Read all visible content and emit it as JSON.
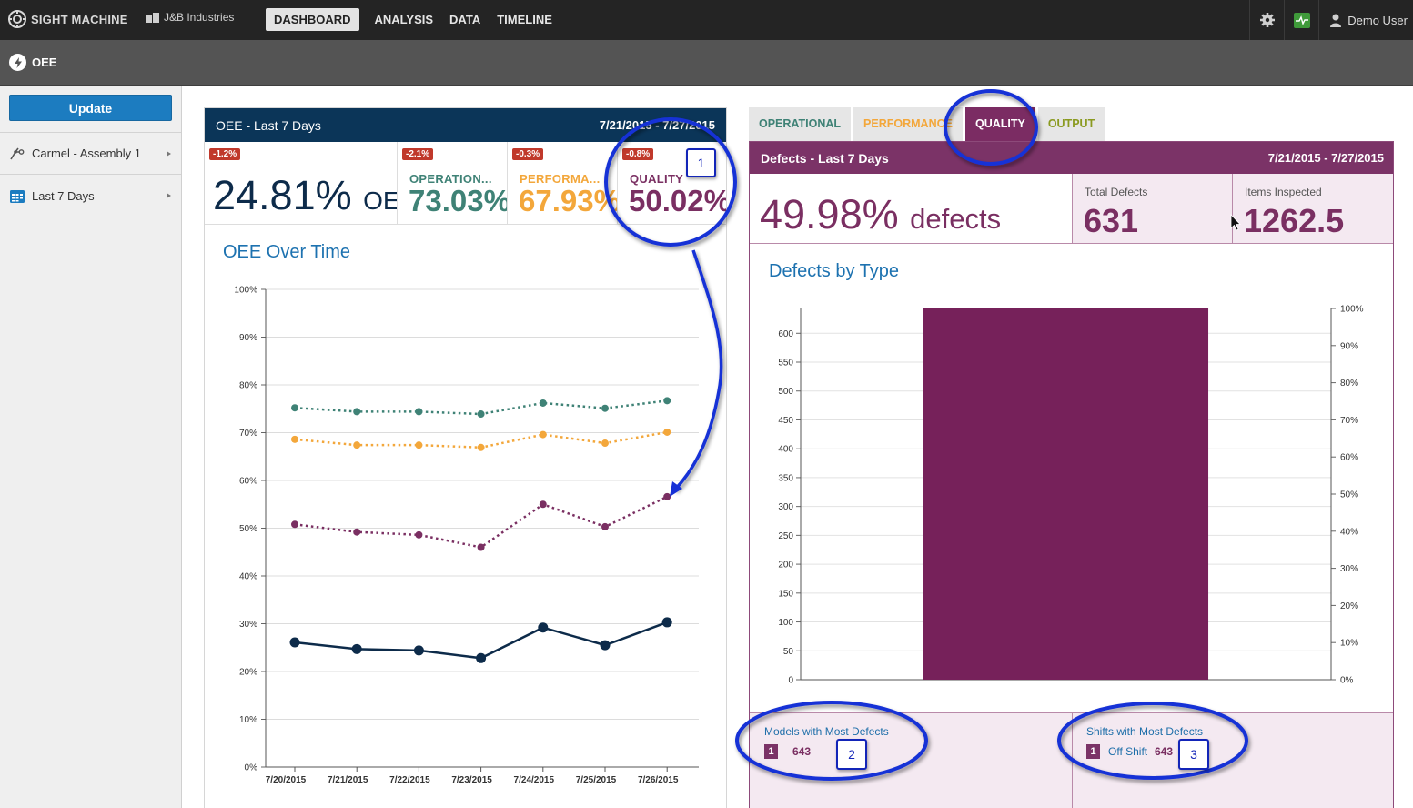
{
  "topbar": {
    "brand": "SIGHT MACHINE",
    "company": "J&B Industries",
    "nav": [
      "DASHBOARD",
      "ANALYSIS",
      "DATA",
      "TIMELINE"
    ],
    "user": "Demo User"
  },
  "subheader": {
    "title": "OEE"
  },
  "sidebar": {
    "update_label": "Update",
    "items": [
      {
        "label": "Carmel - Assembly 1",
        "icon": "machine-icon"
      },
      {
        "label": "Last 7 Days",
        "icon": "calendar-icon"
      }
    ]
  },
  "oee_panel": {
    "title": "OEE - Last 7 Days",
    "date_range": "7/21/2015 - 7/27/2015",
    "kpis": [
      {
        "badge": "-1.2%",
        "label": "",
        "value": "24.81%",
        "unit": "OEE",
        "color": "#0d2b4a"
      },
      {
        "badge": "-2.1%",
        "label": "OPERATION...",
        "value": "73.03%",
        "color": "#3f8276"
      },
      {
        "badge": "-0.3%",
        "label": "PERFORMA...",
        "value": "67.93%",
        "color": "#f3a73b"
      },
      {
        "badge": "-0.8%",
        "label": "QUALITY",
        "value": "50.02%",
        "color": "#7a2f62"
      }
    ],
    "chart_title": "OEE Over Time"
  },
  "quality_panel": {
    "tabs": [
      "OPERATIONAL",
      "PERFORMANCE",
      "QUALITY",
      "OUTPUT"
    ],
    "tab_colors": [
      "#3f8276",
      "#f3a73b",
      "#ffffff",
      "#8a9a20"
    ],
    "title": "Defects - Last 7 Days",
    "date_range": "7/21/2015 - 7/27/2015",
    "main_value": "49.98%",
    "main_unit": "defects",
    "total_defects_label": "Total Defects",
    "total_defects": "631",
    "items_inspected_label": "Items Inspected",
    "items_inspected": "1262.5",
    "chart_title": "Defects by Type",
    "models_label": "Models with Most Defects",
    "models_rank": "1",
    "models_name": "",
    "models_count": "643",
    "shifts_label": "Shifts with Most Defects",
    "shifts_rank": "1",
    "shifts_name": "Off Shift",
    "shifts_count": "643"
  },
  "annotations": [
    "1",
    "2",
    "3"
  ],
  "chart_data": [
    {
      "type": "line",
      "title": "OEE Over Time",
      "x": [
        "7/20/2015",
        "7/21/2015",
        "7/22/2015",
        "7/23/2015",
        "7/24/2015",
        "7/25/2015",
        "7/26/2015"
      ],
      "ylim": [
        0,
        100
      ],
      "yticks": [
        "0%",
        "10%",
        "20%",
        "30%",
        "40%",
        "50%",
        "60%",
        "70%",
        "80%",
        "90%",
        "100%"
      ],
      "grid": true,
      "series": [
        {
          "values": [
            75.2,
            74.4,
            74.4,
            73.9,
            76.2,
            75.1,
            76.7
          ],
          "color": "#3f8276",
          "dashed": true
        },
        {
          "values": [
            68.6,
            67.4,
            67.4,
            66.9,
            69.6,
            67.8,
            70.1
          ],
          "color": "#f3a73b",
          "dashed": true
        },
        {
          "values": [
            50.8,
            49.2,
            48.6,
            46.0,
            55.0,
            50.3,
            56.6
          ],
          "color": "#7a2f62",
          "dashed": true
        },
        {
          "values": [
            26.1,
            24.7,
            24.4,
            22.8,
            29.2,
            25.5,
            30.3
          ],
          "color": "#0d2b4a",
          "dashed": false
        }
      ]
    },
    {
      "type": "bar",
      "title": "Defects by Type",
      "categories": [
        ""
      ],
      "values": [
        643
      ],
      "ylim": [
        0,
        643
      ],
      "yticks": [
        0,
        50,
        100,
        150,
        200,
        250,
        300,
        350,
        400,
        450,
        500,
        550,
        600
      ],
      "y2ticks": [
        "0%",
        "10%",
        "20%",
        "30%",
        "40%",
        "50%",
        "60%",
        "70%",
        "80%",
        "90%",
        "100%"
      ],
      "grid": true,
      "color": "#76215a"
    }
  ]
}
